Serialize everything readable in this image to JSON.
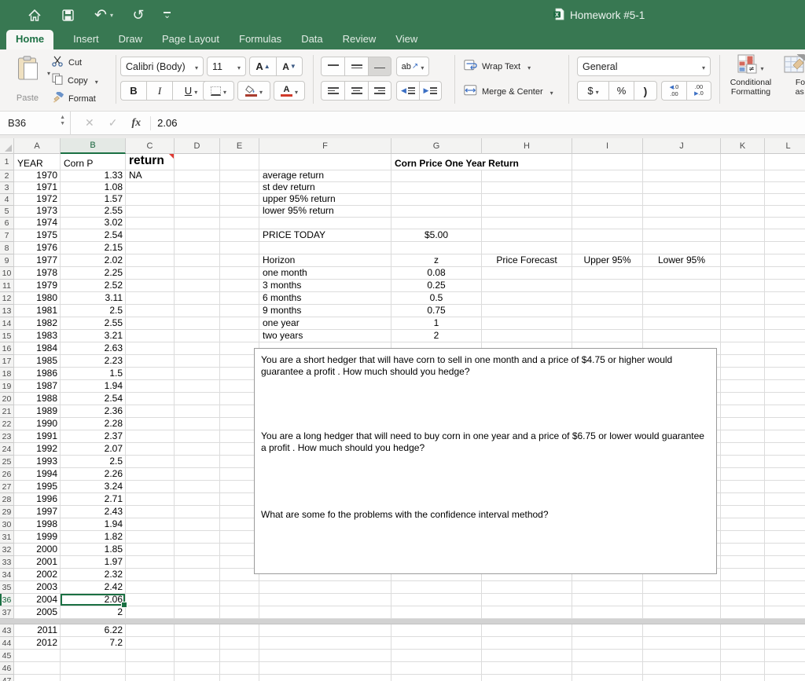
{
  "titlebar": {
    "title": "Homework #5-1"
  },
  "active_tab": "Home",
  "tabs": [
    "Home",
    "Insert",
    "Draw",
    "Page Layout",
    "Formulas",
    "Data",
    "Review",
    "View"
  ],
  "ribbon": {
    "paste_label": "Paste",
    "cut_label": "Cut",
    "copy_label": "Copy",
    "format_label": "Format",
    "font_name": "Calibri (Body)",
    "font_size": "11",
    "bold": "B",
    "italic": "I",
    "underline": "U",
    "grow_font": "A",
    "shrink_font": "A",
    "font_color_letter": "A",
    "orientation_glyph": "ab",
    "wrap_text_label": "Wrap Text",
    "merge_center_label": "Merge & Center",
    "number_format": "General",
    "currency": "$",
    "percent": "%",
    "comma": ")",
    "inc_decimal_top": ".0",
    "inc_decimal_bottom": ".00",
    "dec_decimal_top": ".00",
    "dec_decimal_bottom": ".0",
    "conditional_line1": "Conditional",
    "conditional_line2": "Formatting",
    "format_table_line1": "Forma",
    "format_table_line2": "as Tab"
  },
  "formula_bar": {
    "name_box": "B36",
    "fx_label": "fx",
    "value": "2.06"
  },
  "sheet": {
    "columns": [
      "A",
      "B",
      "C",
      "D",
      "E",
      "F",
      "G",
      "H",
      "I",
      "J",
      "K",
      "L"
    ],
    "selection": {
      "cell": "B36",
      "row": 36,
      "col": "B"
    },
    "row_plan": {
      "first": 1,
      "hidden_after": 37,
      "resume": 43,
      "end": 47
    },
    "header_cells": {
      "A1": "YEAR",
      "B1": "Corn P",
      "C1": "return",
      "G1": "Corn Price One Year Return"
    },
    "labels": {
      "C2": "NA",
      "F2": "average return",
      "F3": "st dev return",
      "F4": "upper 95% return",
      "F5": "lower 95% return",
      "F7": "PRICE TODAY",
      "G7": "$5.00",
      "F9": "Horizon",
      "G9": "z",
      "H9": "Price Forecast",
      "I9": "Upper 95%",
      "J9": "Lower 95%",
      "F10": "one month",
      "G10": "0.08",
      "F11": "3 months",
      "G11": "0.25",
      "F12": "6 months",
      "G12": "0.5",
      "F13": "9 months",
      "G13": "0.75",
      "F14": "one year",
      "G14": "1",
      "F15": "two years",
      "G15": "2"
    },
    "data_rows": [
      [
        1970,
        "1.33"
      ],
      [
        1971,
        "1.08"
      ],
      [
        1972,
        "1.57"
      ],
      [
        1973,
        "2.55"
      ],
      [
        1974,
        "3.02"
      ],
      [
        1975,
        "2.54"
      ],
      [
        1976,
        "2.15"
      ],
      [
        1977,
        "2.02"
      ],
      [
        1978,
        "2.25"
      ],
      [
        1979,
        "2.52"
      ],
      [
        1980,
        "3.11"
      ],
      [
        1981,
        "2.5"
      ],
      [
        1982,
        "2.55"
      ],
      [
        1983,
        "3.21"
      ],
      [
        1984,
        "2.63"
      ],
      [
        1985,
        "2.23"
      ],
      [
        1986,
        "1.5"
      ],
      [
        1987,
        "1.94"
      ],
      [
        1988,
        "2.54"
      ],
      [
        1989,
        "2.36"
      ],
      [
        1990,
        "2.28"
      ],
      [
        1991,
        "2.37"
      ],
      [
        1992,
        "2.07"
      ],
      [
        1993,
        "2.5"
      ],
      [
        1994,
        "2.26"
      ],
      [
        1995,
        "3.24"
      ],
      [
        1996,
        "2.71"
      ],
      [
        1997,
        "2.43"
      ],
      [
        1998,
        "1.94"
      ],
      [
        1999,
        "1.82"
      ],
      [
        2000,
        "1.85"
      ],
      [
        2001,
        "1.97"
      ],
      [
        2002,
        "2.32"
      ],
      [
        2003,
        "2.42"
      ],
      [
        2004,
        "2.06"
      ],
      [
        2005,
        "2"
      ]
    ],
    "extra_rows": [
      {
        "row": 43,
        "year": 2011,
        "price": "6.22"
      },
      {
        "row": 44,
        "year": 2012,
        "price": "7.2"
      }
    ]
  },
  "textbox": {
    "q1": "You are a short hedger that will have corn to sell in one month and a price of $4.75 or higher would guarantee a profit . How much should you hedge?",
    "q2": "You are a long  hedger that will  need to buy corn in one year and a price of $6.75 or lower  would guarantee a profit . How much should you hedge?",
    "q3": "What are some fo the problems with the confidence interval method?"
  },
  "colors": {
    "excel_green": "#1b7043",
    "titlebar_green": "#387852",
    "fill_swatch": "#a93c2e",
    "font_color_swatch": "#d03a2a"
  }
}
